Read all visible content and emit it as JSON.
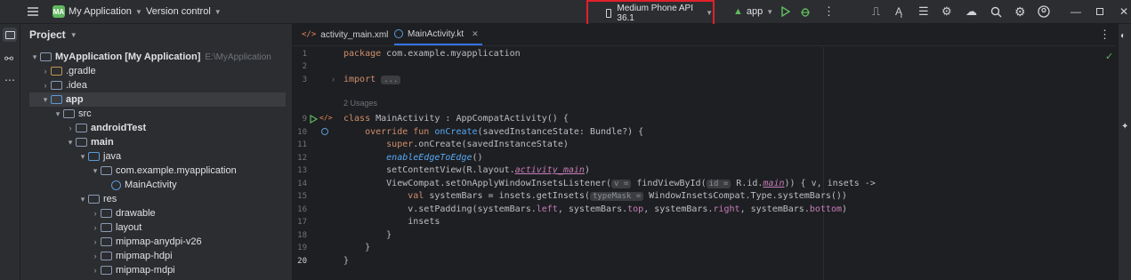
{
  "toolbar": {
    "project_badge": "MA",
    "project_name": "My Application",
    "vcs": "Version control",
    "device": "Medium Phone API 36.1",
    "run_config": "app"
  },
  "project_panel": {
    "title": "Project",
    "tree": [
      {
        "label": "MyApplication [My Application]",
        "sub": "E:\\MyApplication",
        "bold": true
      },
      {
        "label": ".gradle"
      },
      {
        "label": ".idea"
      },
      {
        "label": "app",
        "bold": true
      },
      {
        "label": "src"
      },
      {
        "label": "androidTest",
        "bold": true
      },
      {
        "label": "main",
        "bold": true
      },
      {
        "label": "java"
      },
      {
        "label": "com.example.myapplication"
      },
      {
        "label": "MainActivity"
      },
      {
        "label": "res"
      },
      {
        "label": "drawable"
      },
      {
        "label": "layout"
      },
      {
        "label": "mipmap-anydpi-v26"
      },
      {
        "label": "mipmap-hdpi"
      },
      {
        "label": "mipmap-mdpi"
      }
    ]
  },
  "tabs": [
    {
      "label": "activity_main.xml"
    },
    {
      "label": "MainActivity.kt"
    }
  ],
  "editor": {
    "line_numbers": [
      "1",
      "2",
      "3",
      "",
      "9",
      "10",
      "11",
      "12",
      "13",
      "14",
      "15",
      "16",
      "17",
      "18",
      "19",
      "20"
    ],
    "usages": "2 Usages",
    "lines": {
      "l1a": "package",
      "l1b": " com.example.myapplication",
      "l3a": "import",
      "l3b": "...",
      "l9a": "class",
      "l9b": " MainActivity : AppCompatActivity() {",
      "l10a": "    override fun ",
      "l10b": "onCreate",
      "l10c": "(savedInstanceState: Bundle?) {",
      "l11a": "        super",
      "l11b": ".onCreate(savedInstanceState)",
      "l12": "        enableEdgeToEdge",
      "l12b": "()",
      "l13a": "        setContentView(R.layout.",
      "l13b": "activity_main",
      "l13c": ")",
      "l14a": "        ViewCompat.setOnApplyWindowInsetsListener(",
      "l14h": "v =",
      "l14b": " findViewById(",
      "l14h2": "id =",
      "l14c": " R.id.",
      "l14d": "main",
      "l14e": ")) { v, insets ->",
      "l15a": "            val",
      "l15b": " systemBars = insets.getInsets(",
      "l15h": "typeMask =",
      "l15c": " WindowInsetsCompat.Type.systemBars())",
      "l16a": "            v.setPadding(systemBars.",
      "l16b": "left",
      "l16c": ", systemBars.",
      "l16d": "top",
      "l16e": ", systemBars.",
      "l16f": "right",
      "l16g": ", systemBars.",
      "l16h": "bottom",
      "l16i": ")",
      "l17a": "            insets",
      "l18": "        }",
      "l19": "    }",
      "l20": "}"
    }
  },
  "colors": {
    "accent": "#3574f0",
    "highlight_border": "#e0202a",
    "run_green": "#5fb85f"
  }
}
